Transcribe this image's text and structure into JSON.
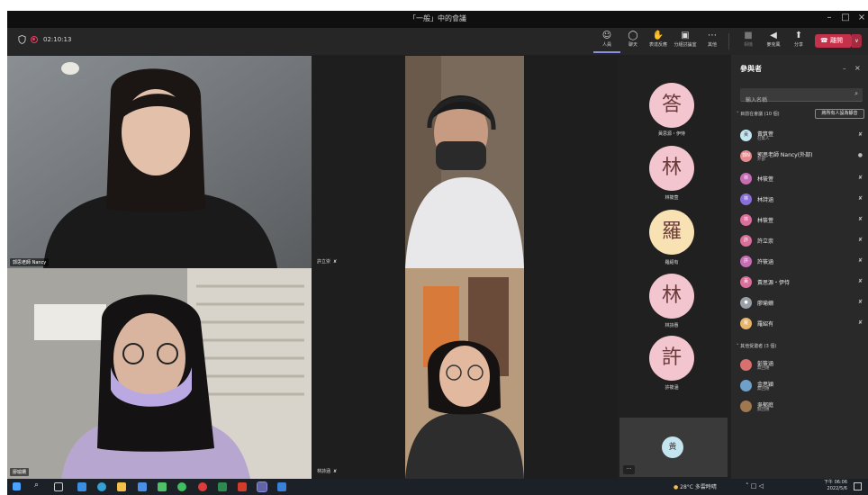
{
  "window": {
    "title": "「一般」中的會議",
    "minimize": "–",
    "maximize": "□",
    "close": "×"
  },
  "meeting": {
    "timer": "02:10:13"
  },
  "toolbar": {
    "people": "人員",
    "chat": "聊天",
    "reactions": "表達反應",
    "rooms": "分組討論室",
    "more": "其他",
    "camera": "相機",
    "mic": "麥克風",
    "share": "分享",
    "leave": "離開"
  },
  "video_tiles": [
    {
      "name": "郭思老師 Nancy"
    },
    {
      "name": "許立崇"
    },
    {
      "name": "廖瑜姍"
    },
    {
      "name": "林詩涵"
    }
  ],
  "avatars": [
    {
      "char": "答",
      "name": "黃思源・伊恃",
      "color": "#f3c6cf"
    },
    {
      "char": "林",
      "name": "林筱萱",
      "color": "#f3c6cf"
    },
    {
      "char": "羅",
      "name": "羅紹有",
      "color": "#f8e2b3"
    },
    {
      "char": "林",
      "name": "林詩惠",
      "color": "#f3c6cf"
    },
    {
      "char": "許",
      "name": "許筱涵",
      "color": "#f3c6cf"
    }
  ],
  "self_view": {
    "initial": "黃",
    "more": "···"
  },
  "panel": {
    "title": "參與者",
    "search_placeholder": "輸入名稱",
    "in_meeting_header": "目前在會議 (10 個)",
    "mute_all": "將所有人設為靜音",
    "others_header": "其他受邀者 (3 個)",
    "participants": [
      {
        "initial": "黃",
        "name": "黃筑萱",
        "role": "召集人",
        "color": "#c4e5f0"
      },
      {
        "initial": "郭N",
        "name": "郭思老師 Nancy(外部)",
        "role": "外部",
        "color": "#e58a8f"
      },
      {
        "initial": "林",
        "name": "林筱萱",
        "role": "",
        "color": "#c56fb3"
      },
      {
        "initial": "林",
        "name": "林詩涵",
        "role": "",
        "color": "#8a6fd8"
      },
      {
        "initial": "林",
        "name": "林筱萱",
        "role": "",
        "color": "#d96f9a"
      },
      {
        "initial": "許",
        "name": "許立崇",
        "role": "",
        "color": "#d96f9a"
      },
      {
        "initial": "許",
        "name": "許筱涵",
        "role": "",
        "color": "#c56fb3"
      },
      {
        "initial": "黃",
        "name": "黃思源・伊恃",
        "role": "",
        "color": "#d96f9a"
      },
      {
        "initial": "",
        "name": "廖瑜姍",
        "role": "",
        "color": "#9aa0a8"
      },
      {
        "initial": "羅",
        "name": "羅紹有",
        "role": "",
        "color": "#e8b46a"
      }
    ],
    "others": [
      {
        "initial": "",
        "name": "彭筱涵",
        "role": "無回應",
        "color": "#d97070"
      },
      {
        "initial": "",
        "name": "金思穎",
        "role": "無回應",
        "color": "#6fa0c8"
      },
      {
        "initial": "",
        "name": "吳郁庭",
        "role": "無回應",
        "color": "#a07850"
      }
    ]
  },
  "taskbar": {
    "weather": "28°C  多雲時晴",
    "time": "下午 06:06",
    "date": "2022/5/6"
  }
}
